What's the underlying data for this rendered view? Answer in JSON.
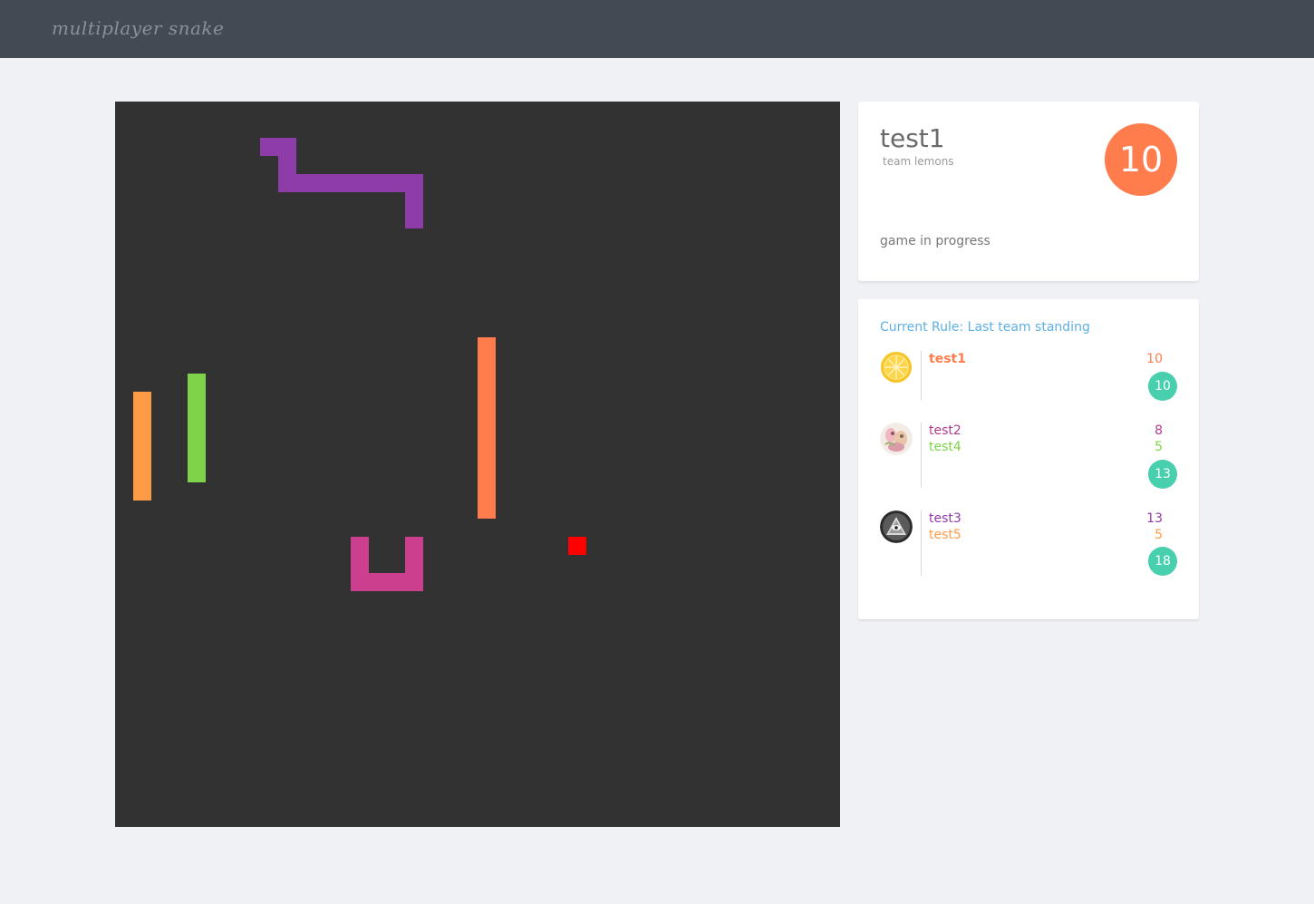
{
  "app": {
    "brand": "multiplayer snake"
  },
  "player": {
    "name": "test1",
    "team": "team lemons",
    "score": "10",
    "status": "game in progress",
    "score_color": "#ff7d4d"
  },
  "rules": {
    "title": "Current Rule: Last team standing"
  },
  "teams": [
    {
      "avatar": "lemon-avatar-icon",
      "members": [
        {
          "name": "test1",
          "score": "10",
          "color": "#ff7d4d",
          "bold": true
        }
      ],
      "total": "10"
    },
    {
      "avatar": "illustration-avatar-icon",
      "members": [
        {
          "name": "test2",
          "score": "8",
          "color": "#b33b8c",
          "bold": false
        },
        {
          "name": "test4",
          "score": "5",
          "color": "#7ed348",
          "bold": false
        }
      ],
      "total": "13"
    },
    {
      "avatar": "eye-pyramid-avatar-icon",
      "members": [
        {
          "name": "test3",
          "score": "13",
          "color": "#8e3ca8",
          "bold": false
        },
        {
          "name": "test5",
          "score": "5",
          "color": "#ff9a45",
          "bold": false
        }
      ],
      "total": "18"
    }
  ],
  "board": {
    "background": "#323232",
    "grid_cells": 40,
    "food": {
      "color": "#ff0000",
      "cell": [
        25,
        24
      ]
    },
    "snakes": [
      {
        "color": "#8e3ca8",
        "cells": [
          [
            8,
            2
          ],
          [
            9,
            2
          ],
          [
            9,
            3
          ],
          [
            9,
            4
          ],
          [
            10,
            4
          ],
          [
            11,
            4
          ],
          [
            12,
            4
          ],
          [
            13,
            4
          ],
          [
            14,
            4
          ],
          [
            15,
            4
          ],
          [
            16,
            4
          ],
          [
            16,
            5
          ],
          [
            16,
            6
          ]
        ]
      },
      {
        "color": "#ff9a45",
        "cells": [
          [
            1,
            16
          ],
          [
            1,
            17
          ],
          [
            1,
            18
          ],
          [
            1,
            19
          ],
          [
            1,
            20
          ],
          [
            1,
            21
          ]
        ]
      },
      {
        "color": "#7ed348",
        "cells": [
          [
            4,
            15
          ],
          [
            4,
            16
          ],
          [
            4,
            17
          ],
          [
            4,
            18
          ],
          [
            4,
            19
          ],
          [
            4,
            20
          ]
        ]
      },
      {
        "color": "#ff7d4d",
        "cells": [
          [
            20,
            13
          ],
          [
            20,
            14
          ],
          [
            20,
            15
          ],
          [
            20,
            16
          ],
          [
            20,
            17
          ],
          [
            20,
            18
          ],
          [
            20,
            19
          ],
          [
            20,
            20
          ],
          [
            20,
            21
          ],
          [
            20,
            22
          ]
        ]
      },
      {
        "color": "#cc3f8f",
        "cells": [
          [
            13,
            24
          ],
          [
            13,
            25
          ],
          [
            13,
            26
          ],
          [
            14,
            26
          ],
          [
            15,
            26
          ],
          [
            16,
            26
          ],
          [
            16,
            25
          ],
          [
            16,
            24
          ]
        ]
      }
    ]
  }
}
